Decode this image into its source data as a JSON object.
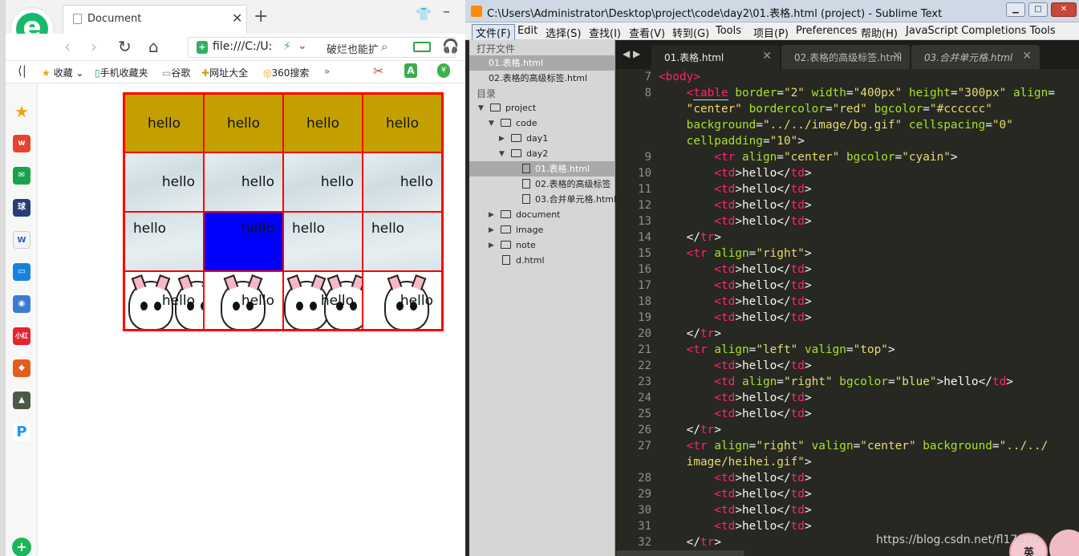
{
  "browser": {
    "tab_title": "Document",
    "tab_close": "✕",
    "new_tab": "+",
    "address": "file:///C:/U:",
    "search_text": "破烂也能扩",
    "bookmarks": [
      "收藏",
      "手机收藏夹",
      "谷歌",
      "网址大全",
      "360搜索"
    ],
    "bookmarks_more": "»",
    "table": [
      [
        "hello",
        "hello",
        "hello",
        "hello"
      ],
      [
        "hello",
        "hello",
        "hello",
        "hello"
      ],
      [
        "hello",
        "hello",
        "hello",
        "hello"
      ],
      [
        "hello",
        "hello",
        "hello",
        "hello"
      ]
    ]
  },
  "sublime": {
    "title": "C:\\Users\\Administrator\\Desktop\\project\\code\\day2\\01.表格.html (project) - Sublime Text",
    "menu": [
      "文件(F)",
      "Edit",
      "选择(S)",
      "查找(I)",
      "查看(V)",
      "转到(G)",
      "Tools",
      "项目(P)",
      "Preferences",
      "帮助(H)",
      "JavaScript Completions Tools"
    ],
    "sidebar": {
      "open_files_header": "打开文件",
      "open_files": [
        "01.表格.html",
        "02.表格的高级标签.html"
      ],
      "folders_header": "目录",
      "tree": [
        "project",
        "code",
        "day1",
        "day2",
        "01.表格.html",
        "02.表格的高级标签",
        "03.合并单元格.html",
        "document",
        "image",
        "note",
        "d.html"
      ]
    },
    "tabs": [
      "01.表格.html",
      "02.表格的高级标签.html",
      "03.合并单元格.html"
    ],
    "tab_close": "✕",
    "line_numbers": [
      "7",
      "8",
      "",
      "",
      "",
      "9",
      "10",
      "11",
      "12",
      "13",
      "14",
      "15",
      "16",
      "17",
      "18",
      "19",
      "20",
      "21",
      "22",
      "23",
      "24",
      "25",
      "26",
      "27",
      "",
      "28",
      "29",
      "30",
      "31",
      "32"
    ],
    "watermark": "https://blog.csdn.net/fl17870",
    "ime_label": "英"
  }
}
